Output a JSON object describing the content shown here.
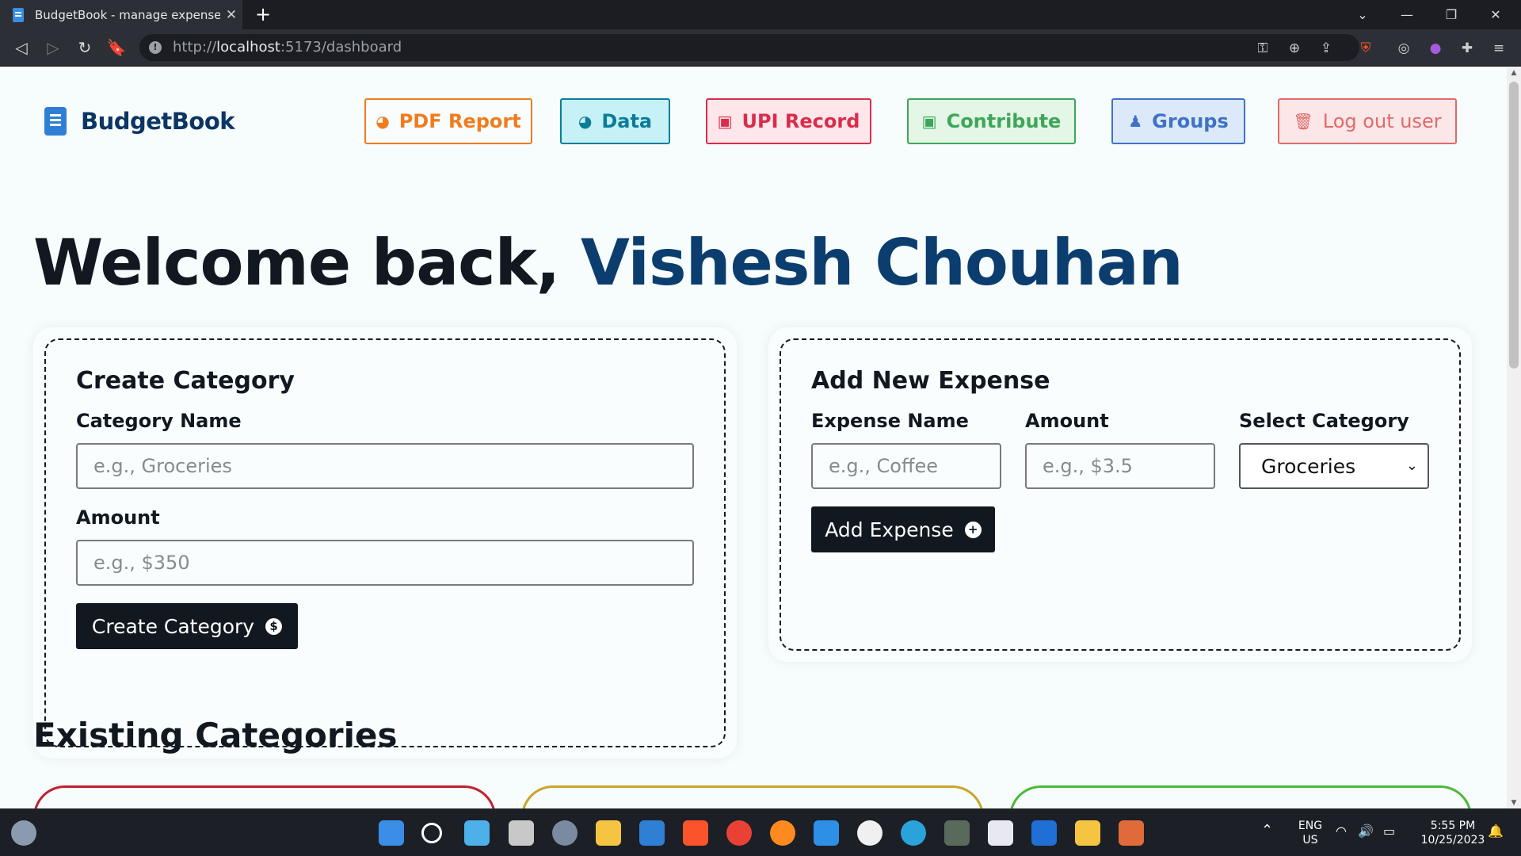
{
  "browser": {
    "tab_title": "BudgetBook - manage expenses",
    "tab_close": "✕",
    "new_tab": "+",
    "url_prefix": "http://",
    "url_host": "localhost",
    "url_path": ":5173/dashboard"
  },
  "header": {
    "brand": "BudgetBook",
    "nav": [
      {
        "label": "PDF Report",
        "color": "#f07c1e"
      },
      {
        "label": "Data",
        "color": "#0b7d9a"
      },
      {
        "label": "UPI Record",
        "color": "#d92d4a"
      },
      {
        "label": "Contribute",
        "color": "#3ea65a"
      },
      {
        "label": "Groups",
        "color": "#3f72c6"
      },
      {
        "label": "Log out user",
        "color": "#e06a6a"
      }
    ]
  },
  "welcome": {
    "greeting": "Welcome back, ",
    "user_name": "Vishesh Chouhan"
  },
  "create_category": {
    "title": "Create Category",
    "name_label": "Category Name",
    "name_placeholder": "e.g., Groceries",
    "amount_label": "Amount",
    "amount_placeholder": "e.g., $350",
    "button": "Create Category",
    "button_icon": "$"
  },
  "add_expense": {
    "title": "Add New Expense",
    "name_label": "Expense Name",
    "name_placeholder": "e.g., Coffee",
    "amount_label": "Amount",
    "amount_placeholder": "e.g., $3.5",
    "category_label": "Select Category",
    "category_selected": "Groceries",
    "button": "Add Expense",
    "button_icon": "+"
  },
  "existing": {
    "title": "Existing Categories",
    "card_colors": [
      "#c0202e",
      "#c9a52a",
      "#4cb83a"
    ]
  },
  "taskbar": {
    "lang": "ENG",
    "region": "US",
    "time": "5:55 PM",
    "date": "10/25/2023"
  }
}
